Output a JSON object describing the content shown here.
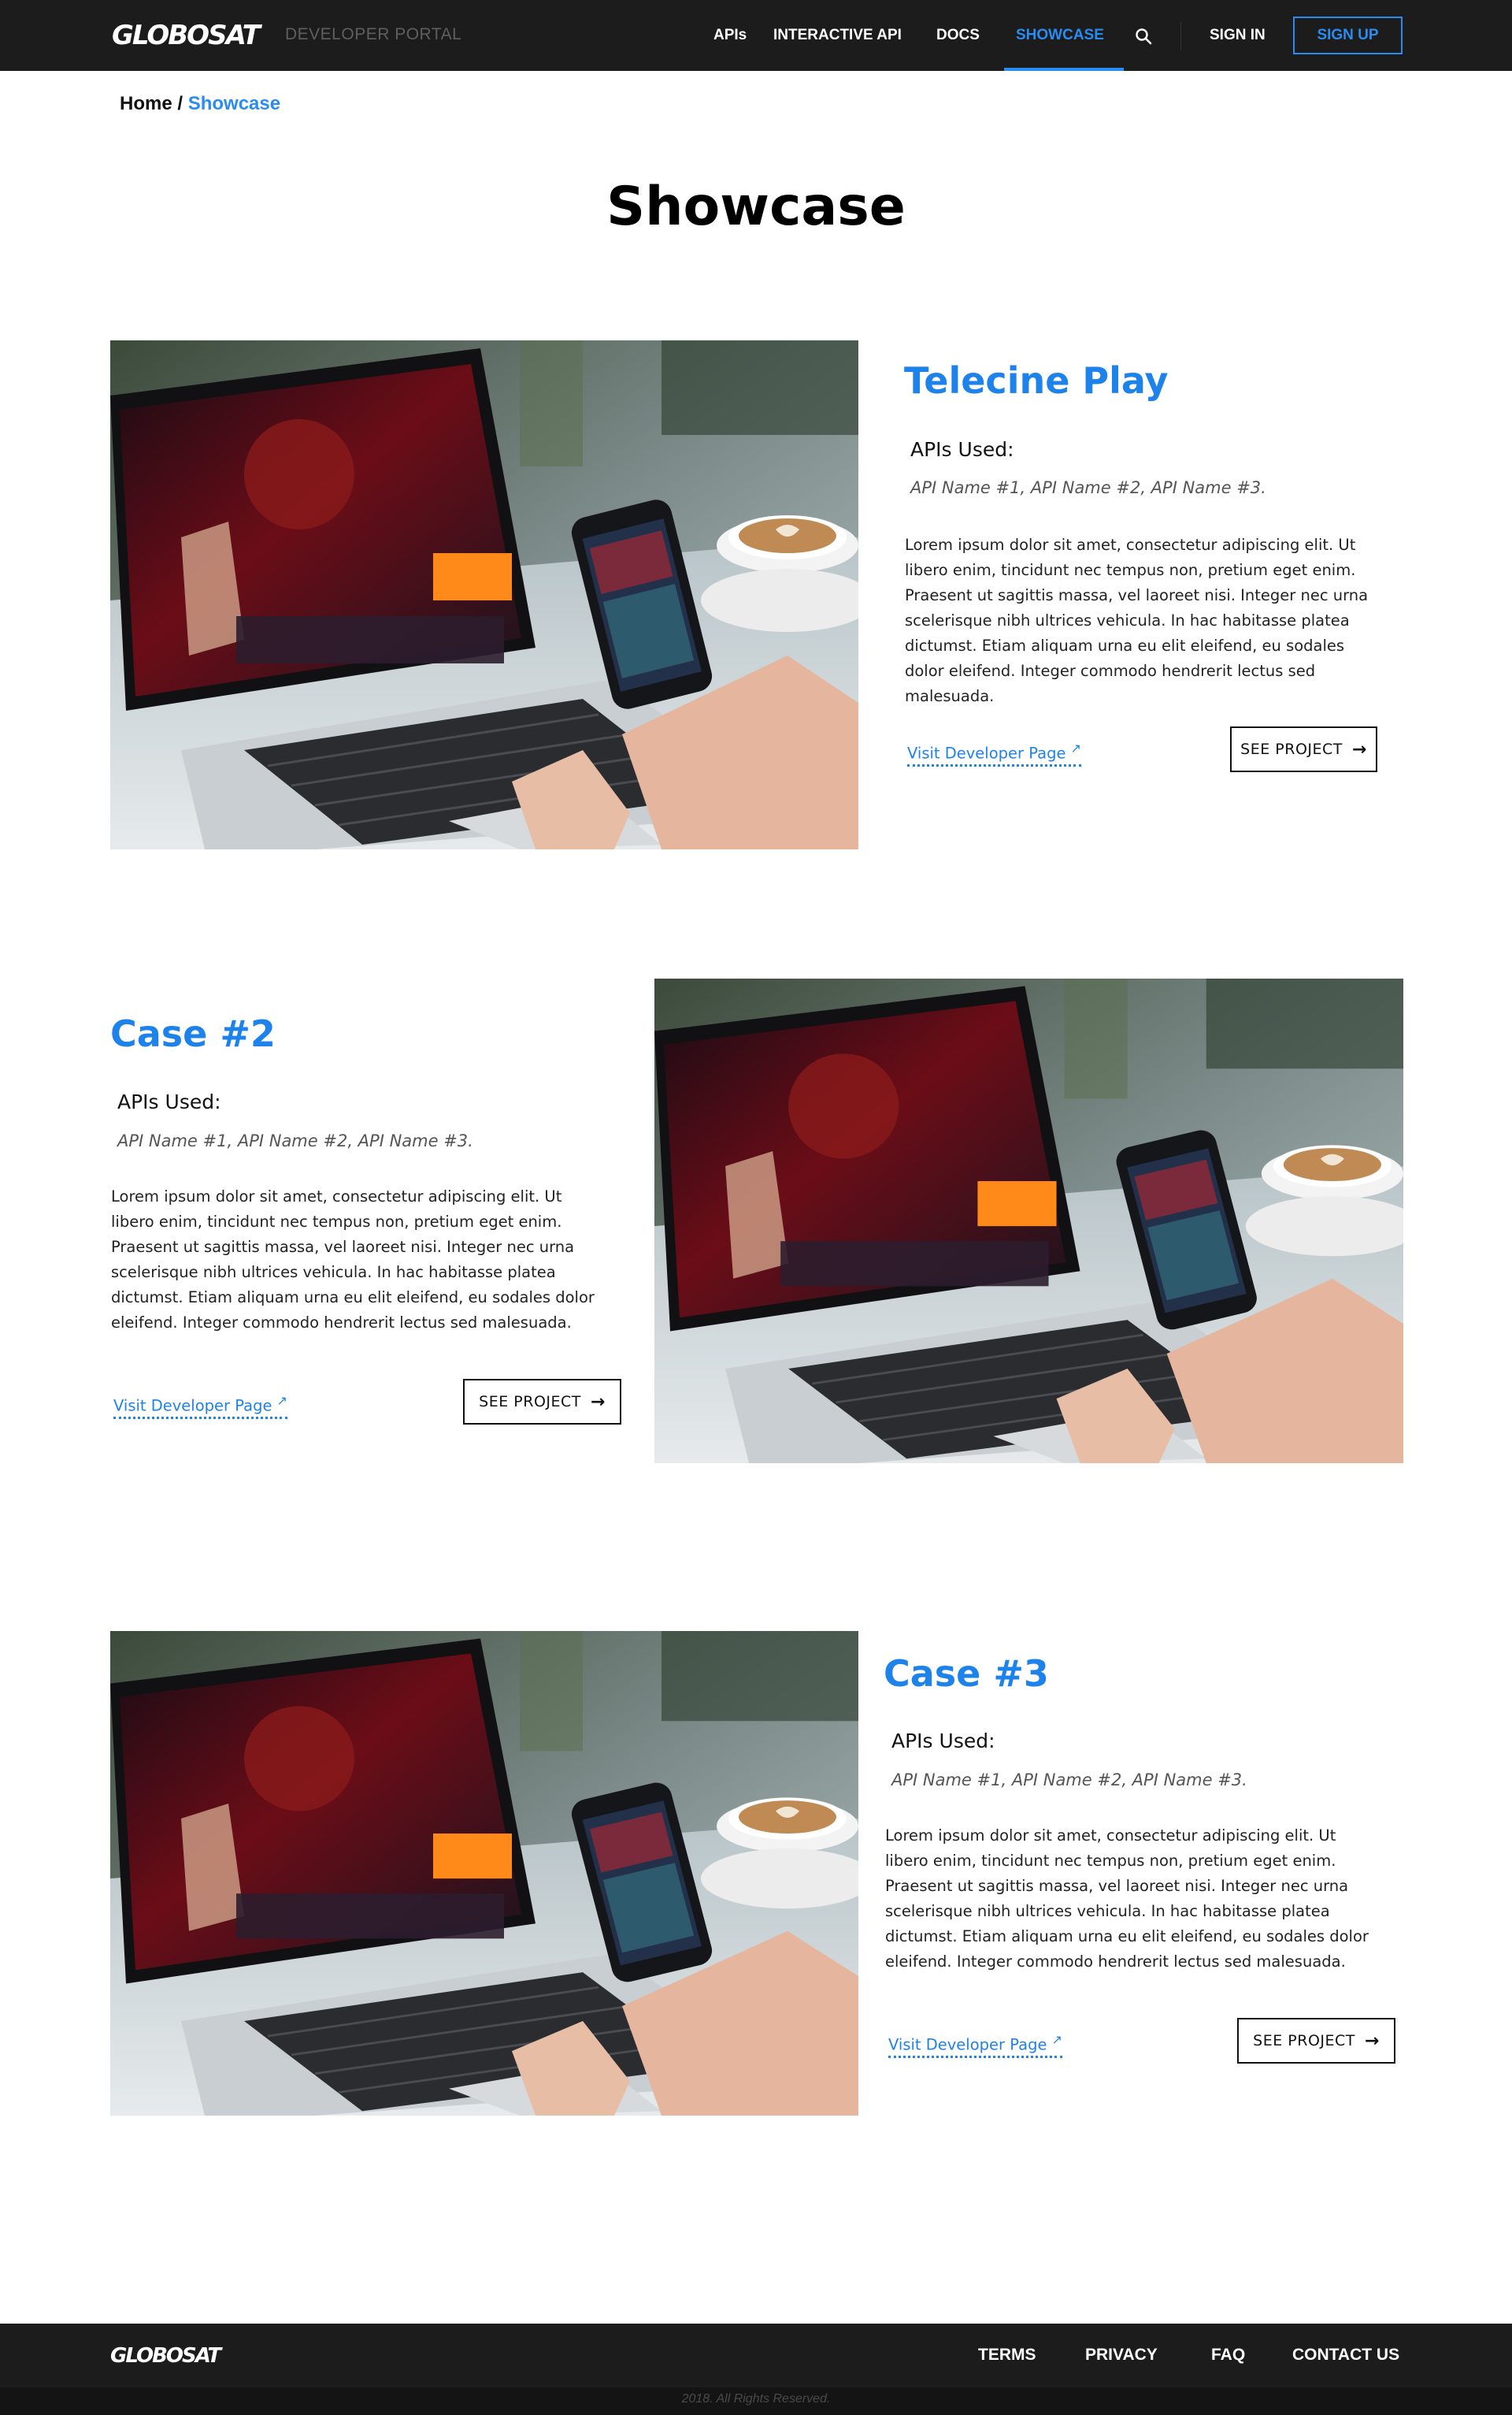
{
  "header": {
    "logo_text": "GLOBOSAT",
    "portal_label": "DEVELOPER PORTAL",
    "nav": [
      {
        "label": "APIs"
      },
      {
        "label": "INTERACTIVE API"
      },
      {
        "label": "DOCS"
      },
      {
        "label": "SHOWCASE"
      }
    ],
    "active_nav": "SHOWCASE",
    "search_icon": "search-icon",
    "sign_in_label": "SIGN IN",
    "sign_up_label": "SIGN UP",
    "accent_color": "#2a8cf0",
    "background_color": "#1c1c1c"
  },
  "breadcrumb": {
    "home": "Home",
    "separator": "/",
    "current": "Showcase"
  },
  "page_title": "Showcase",
  "cases": [
    {
      "title": "Telecine Play",
      "apis_label": "APIs Used:",
      "apis_list": "API Name #1,  API Name #2, API Name #3.",
      "description": "Lorem ipsum dolor sit amet, consectetur adipiscing elit. Ut libero enim, tincidunt nec tempus non, pretium eget enim. Praesent ut sagittis massa, vel laoreet nisi. Integer nec urna scelerisque nibh ultrices vehicula. In hac habitasse platea dictumst. Etiam aliquam urna eu elit eleifend, eu sodales dolor eleifend. Integer commodo hendrerit lectus sed malesuada.",
      "dev_link_label": "Visit Developer Page",
      "see_project_label": "SEE  PROJECT",
      "image_alt": "laptop-and-phone-photo"
    },
    {
      "title": "Case #2",
      "apis_label": "APIs Used:",
      "apis_list": "API Name #1,  API Name #2, API Name #3.",
      "description": "Lorem ipsum dolor sit amet, consectetur adipiscing elit. Ut libero enim, tincidunt nec tempus non, pretium eget enim. Praesent ut sagittis massa, vel laoreet nisi. Integer nec urna scelerisque nibh ultrices vehicula. In hac habitasse platea dictumst. Etiam aliquam urna eu elit eleifend, eu sodales dolor eleifend. Integer commodo hendrerit lectus sed malesuada.",
      "dev_link_label": "Visit Developer Page",
      "see_project_label": "SEE  PROJECT",
      "image_alt": "laptop-and-phone-photo"
    },
    {
      "title": "Case #3",
      "apis_label": "APIs Used:",
      "apis_list": "API Name #1,  API Name #2, API Name #3.",
      "description": "Lorem ipsum dolor sit amet, consectetur adipiscing elit. Ut libero enim, tincidunt nec tempus non, pretium eget enim. Praesent ut sagittis massa, vel laoreet nisi. Integer nec urna scelerisque nibh ultrices vehicula. In hac habitasse platea dictumst. Etiam aliquam urna eu elit eleifend, eu sodales dolor eleifend. Integer commodo hendrerit lectus sed malesuada.",
      "dev_link_label": "Visit Developer Page",
      "see_project_label": "SEE  PROJECT",
      "image_alt": "laptop-and-phone-photo"
    }
  ],
  "case_title_color": "#1e82eb",
  "footer": {
    "logo_text": "GLOBOSAT",
    "links": [
      {
        "label": "TERMS"
      },
      {
        "label": "PRIVACY"
      },
      {
        "label": "FAQ"
      },
      {
        "label": "CONTACT US"
      }
    ],
    "copyright": "2018. All Rights Reserved."
  }
}
